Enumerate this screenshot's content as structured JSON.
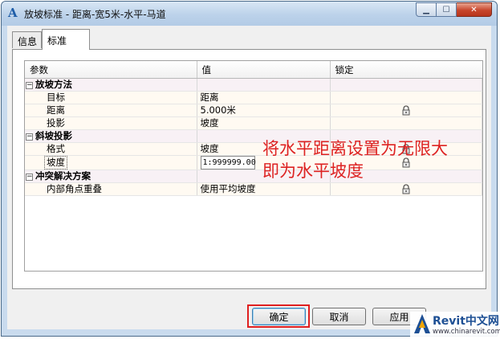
{
  "window": {
    "title": "放坡标准 - 距离-宽5米-水平-马道",
    "accent_color": "#bcd2ea",
    "close_color": "#c7462c"
  },
  "tabs": [
    {
      "label": "信息",
      "active": false
    },
    {
      "label": "标准",
      "active": true
    }
  ],
  "grid": {
    "columns": [
      "参数",
      "值",
      "锁定"
    ],
    "groups": [
      {
        "label": "放坡方法",
        "expanded": true,
        "rows": [
          {
            "name": "目标",
            "value": "距离",
            "locked": false
          },
          {
            "name": "距离",
            "value": "5.000米",
            "locked": true
          },
          {
            "name": "投影",
            "value": "坡度",
            "locked": false
          }
        ]
      },
      {
        "label": "斜坡投影",
        "expanded": true,
        "rows": [
          {
            "name": "格式",
            "value": "坡度",
            "locked": true
          },
          {
            "name": "坡度",
            "value": "1:999999.00",
            "locked": true,
            "editing": true
          }
        ]
      },
      {
        "label": "冲突解决方案",
        "expanded": true,
        "rows": [
          {
            "name": "内部角点重叠",
            "value": "使用平均坡度",
            "locked": true
          }
        ]
      }
    ]
  },
  "annotation": {
    "line1": "将水平距离设置为无限大",
    "line2": "即为水平坡度",
    "color": "#d22222"
  },
  "buttons": {
    "ok": "确定",
    "cancel": "取消",
    "apply": "应用"
  },
  "watermark": {
    "title": "Revit中文网",
    "url": "www.chinarevit.com"
  },
  "icons": [
    "app-icon",
    "minimize-icon",
    "maximize-icon",
    "close-icon",
    "lock-icon",
    "collapse-icon"
  ]
}
